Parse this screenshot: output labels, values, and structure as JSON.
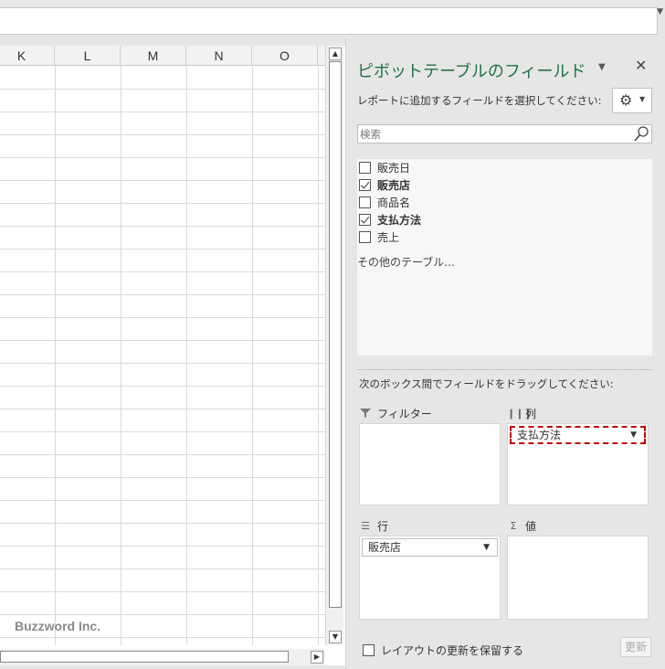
{
  "grid": {
    "columns": [
      "K",
      "L",
      "M",
      "N",
      "O"
    ]
  },
  "watermark": "Buzzword Inc.",
  "pivot_pane": {
    "title": "ピボットテーブルのフィールド",
    "subtitle": "レポートに追加するフィールドを選択してください:",
    "search_placeholder": "検索",
    "fields": [
      {
        "label": "販売日",
        "checked": false
      },
      {
        "label": "販売店",
        "checked": true
      },
      {
        "label": "商品名",
        "checked": false
      },
      {
        "label": "支払方法",
        "checked": true
      },
      {
        "label": "売上",
        "checked": false
      }
    ],
    "more_tables": "その他のテーブル...",
    "drag_label": "次のボックス間でフィールドをドラッグしてください:",
    "areas": {
      "filter": {
        "label": "フィルター",
        "items": []
      },
      "columns": {
        "label": "列",
        "items": [
          "支払方法"
        ]
      },
      "rows": {
        "label": "行",
        "items": [
          "販売店"
        ]
      },
      "values": {
        "label": "値",
        "items": []
      }
    },
    "defer_label": "レイアウトの更新を保留する",
    "update_label": "更新"
  },
  "colors": {
    "title": "#217346",
    "highlight": "#c00000"
  },
  "icons": {
    "gear": "gear-icon",
    "search": "search-icon",
    "close": "close-icon",
    "filter": "filter-icon",
    "columns": "columns-icon",
    "rows": "rows-icon",
    "sigma": "sigma-icon"
  }
}
